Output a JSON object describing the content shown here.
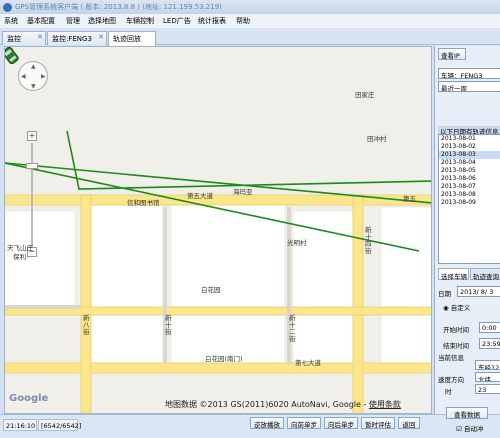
{
  "app": {
    "title": "GPS管理系统客户端 ( 版本: 2013.8.8 )   (地址: 121.199.53.219)"
  },
  "menu": [
    "系统",
    "基本配置",
    "管理",
    "选择地图",
    "车辆控制",
    "LED广告",
    "统计报表",
    "帮助"
  ],
  "tabs": [
    {
      "label": "监控",
      "closable": true
    },
    {
      "label": "监控:FENG3",
      "closable": true
    },
    {
      "label": "轨迹回放",
      "closable": false,
      "active": true
    }
  ],
  "map": {
    "labels": {
      "tian_jia_zhuang": "田家庄",
      "tian_chong_cun": "田冲村",
      "di_wu_da_dao": "第五大道",
      "di_wu": "第五",
      "hai_ma_ya": "海玛亚",
      "xin_ma_tu_shu": "信和图书馆",
      "guang_ming_cun": "光明村",
      "xin_shi_si_jie": "新十四街",
      "bai_hua_yuan": "白花园",
      "bai_hua_zhen": "白花园(南门)",
      "xin_shi_er_jie": "新十二街",
      "xin_shi_jie": "新十街",
      "xin_ba_jie": "新八街",
      "di_qi_da_dao": "第七大道",
      "tian_shan_yan_sha": "天飞山庄",
      "bao_li": "保利"
    },
    "attribution": "地图数据 ©2013 GS(2011)6020 AutoNavi, Google -",
    "terms_link": "使用条款",
    "google_logo": "Google",
    "track_color": "#1c8a1c",
    "road_color": "#fbe68a",
    "nav_icons": {
      "pan": "pan-control-icon",
      "pegman": "pegman-icon",
      "car": "car-icon"
    }
  },
  "status": {
    "time": "21:16:10",
    "progress": "[6542/6542]",
    "buttons": [
      "逆放播放",
      "向前单步",
      "向后单步",
      "暂时评估",
      "返回"
    ]
  },
  "right_panel": {
    "query_button": "查看IP",
    "vehicle_label": "车辆：FENG3",
    "period": "最近一周",
    "list_header": "以下日期有轨迹信息",
    "dates": [
      "2013-08-01",
      "2013-08-02",
      "2013-08-03",
      "2013-08-04",
      "2013-08-05",
      "2013-08-06",
      "2013-08-07",
      "2013-08-08",
      "2013-08-09"
    ],
    "selected_date_index": 2,
    "sub_tabs": [
      "选择车辆",
      "轨迹查询"
    ],
    "date_label": "日期",
    "date_value": "2013/ 8/ 3",
    "custom_label": "自定义",
    "start_label": "开始时间",
    "start_value": "0:00",
    "end_label": "结束时间",
    "end_value": "23:59",
    "info_header": "当前信息",
    "speed_label": "速度方向",
    "speed_value": "东经12",
    "dir_value": "北纬",
    "time_label": "时",
    "time_value": "23",
    "query_track_button": "查看数据",
    "auto_checkbox": "自动冲"
  }
}
